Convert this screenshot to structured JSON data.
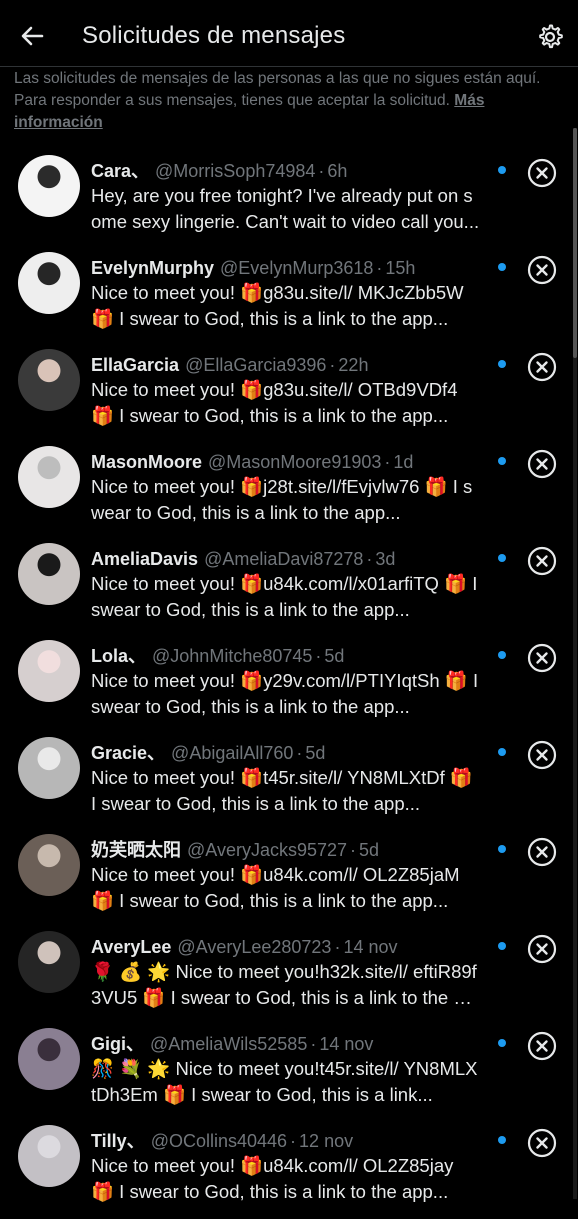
{
  "header": {
    "title": "Solicitudes de mensajes",
    "back_icon": "arrow-left-icon",
    "settings_icon": "gear-icon"
  },
  "notice": {
    "text": "Las solicitudes de mensajes de las personas a las que no sigues están aquí. Para responder a sus mensajes, tienes que aceptar la solicitud.",
    "link": "Más información"
  },
  "colors": {
    "background": "#000000",
    "text": "#e7e9ea",
    "muted": "#71767b",
    "unread_dot": "#1d9bf0"
  },
  "requests": [
    {
      "name": "Cara、",
      "handle": "@MorrisSoph74984",
      "time": "6h",
      "message": "Hey, are you free tonight? I've already put on some sexy lingerie. Can't wait to video call you...",
      "unread": true
    },
    {
      "name": "EvelynMurphy",
      "handle": "@EvelynMurp3618",
      "time": "15h",
      "message": "Nice to meet you! 🎁g83u.site/l/ MKJcZbb5W 🎁 I swear to God, this is a link to the app...",
      "unread": true
    },
    {
      "name": "EllaGarcia",
      "handle": "@EllaGarcia9396",
      "time": "22h",
      "message": "Nice to meet you! 🎁g83u.site/l/ OTBd9VDf4 🎁 I swear to God, this is a link to the app...",
      "unread": true
    },
    {
      "name": "MasonMoore",
      "handle": "@MasonMoore91903",
      "time": "1d",
      "message": "Nice to meet you! 🎁j28t.site/l/fEvjvlw76 🎁 I swear to God, this is a link to the app...",
      "unread": true
    },
    {
      "name": "AmeliaDavis",
      "handle": "@AmeliaDavi87278",
      "time": "3d",
      "message": "Nice to meet you! 🎁u84k.com/l/x01arfiTQ 🎁 I swear to God, this is a link to the app...",
      "unread": true
    },
    {
      "name": "Lola、",
      "handle": "@JohnMitche80745",
      "time": "5d",
      "message": "Nice to meet you! 🎁y29v.com/l/PTIYIqtSh 🎁 I swear to God, this is a link to the app...",
      "unread": true
    },
    {
      "name": "Gracie、",
      "handle": "@AbigailAll760",
      "time": "5d",
      "message": "Nice to meet you! 🎁t45r.site/l/ YN8MLXtDf 🎁 I swear to God, this is a link to the app...",
      "unread": true
    },
    {
      "name": "奶芙晒太阳",
      "handle": "@AveryJacks95727",
      "time": "5d",
      "message": "Nice to meet you! 🎁u84k.com/l/ OL2Z85jaM 🎁 I swear to God, this is a link to the app...",
      "unread": true
    },
    {
      "name": "AveryLee",
      "handle": "@AveryLee280723",
      "time": "14 nov",
      "message": "🌹 💰 🌟 Nice to meet you!h32k.site/l/ eftiR89f3VU5 🎁 I swear to God, this is a link to the app...",
      "unread": true
    },
    {
      "name": "Gigi、",
      "handle": "@AmeliaWils52585",
      "time": "14 nov",
      "message": "🎊 💐 🌟 Nice to meet you!t45r.site/l/ YN8MLXtDh3Em 🎁 I swear to God, this is a link...",
      "unread": true
    },
    {
      "name": "Tilly、",
      "handle": "@OCollins40446",
      "time": "12 nov",
      "message": "Nice to meet you! 🎁u84k.com/l/ OL2Z85jay 🎁 I swear to God, this is a link to the app...",
      "unread": true
    }
  ]
}
